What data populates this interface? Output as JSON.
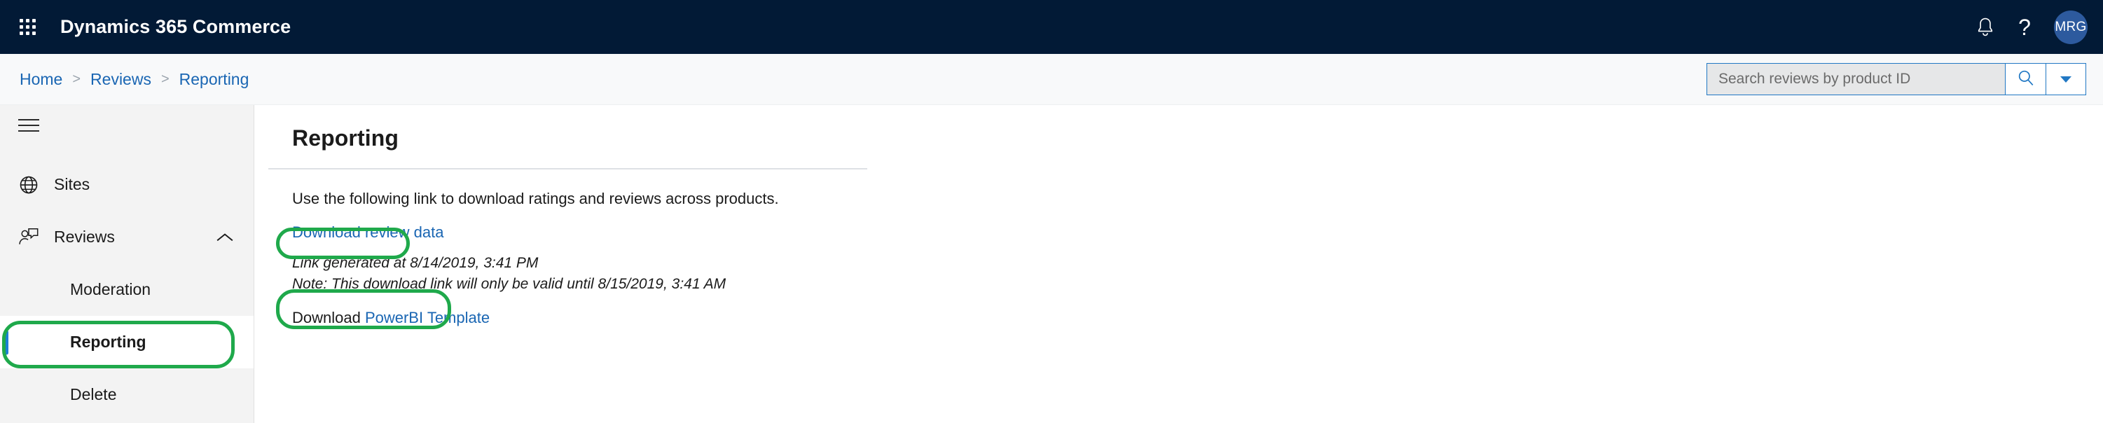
{
  "suite": {
    "waffle_icon": "app-launcher-icon",
    "title": "Dynamics 365 Commerce",
    "notifications_icon": "bell-icon",
    "help_icon": "question-mark-icon",
    "help_glyph": "?",
    "avatar_initials": "MRG",
    "background_color": "#021A36",
    "avatar_color": "#2D5A9E"
  },
  "commandbar": {
    "breadcrumb": [
      {
        "label": "Home"
      },
      {
        "label": "Reviews"
      },
      {
        "label": "Reporting"
      }
    ],
    "separator": ">",
    "search": {
      "placeholder": "Search reviews by product ID",
      "value": "",
      "search_icon": "magnifier-icon",
      "dropdown_icon": "chevron-down-icon"
    },
    "link_color": "#1A66B3",
    "border_color": "#2178C4"
  },
  "sidebar": {
    "hamburger_icon": "hamburger-menu-icon",
    "items": [
      {
        "label": "Sites",
        "icon": "globe-icon",
        "level": "top",
        "selected": false
      },
      {
        "label": "Reviews",
        "icon": "person-chat-icon",
        "level": "top",
        "selected": false,
        "expanded": true,
        "chevron": "chevron-up-icon"
      },
      {
        "label": "Moderation",
        "icon": "",
        "level": "sub",
        "selected": false
      },
      {
        "label": "Reporting",
        "icon": "",
        "level": "sub",
        "selected": true
      },
      {
        "label": "Delete",
        "icon": "",
        "level": "sub",
        "selected": false
      }
    ],
    "selected_indicator_color": "#1D7FD4",
    "background_color": "#F3F3F3"
  },
  "main": {
    "title": "Reporting",
    "description": "Use the following link to download ratings and reviews across products.",
    "download_link": "Download review data",
    "generated_note": "Link generated at 8/14/2019, 3:41 PM",
    "validity_note": "Note: This download link will only be valid until 8/15/2019, 3:41 AM",
    "powerbi_prefix": "Download ",
    "powerbi_link": "PowerBI Template"
  },
  "annotations": {
    "color": "#1FA94B",
    "targets": [
      "sidebar-item-reporting",
      "download-review-data-link",
      "download-powerbi-template-link"
    ]
  }
}
